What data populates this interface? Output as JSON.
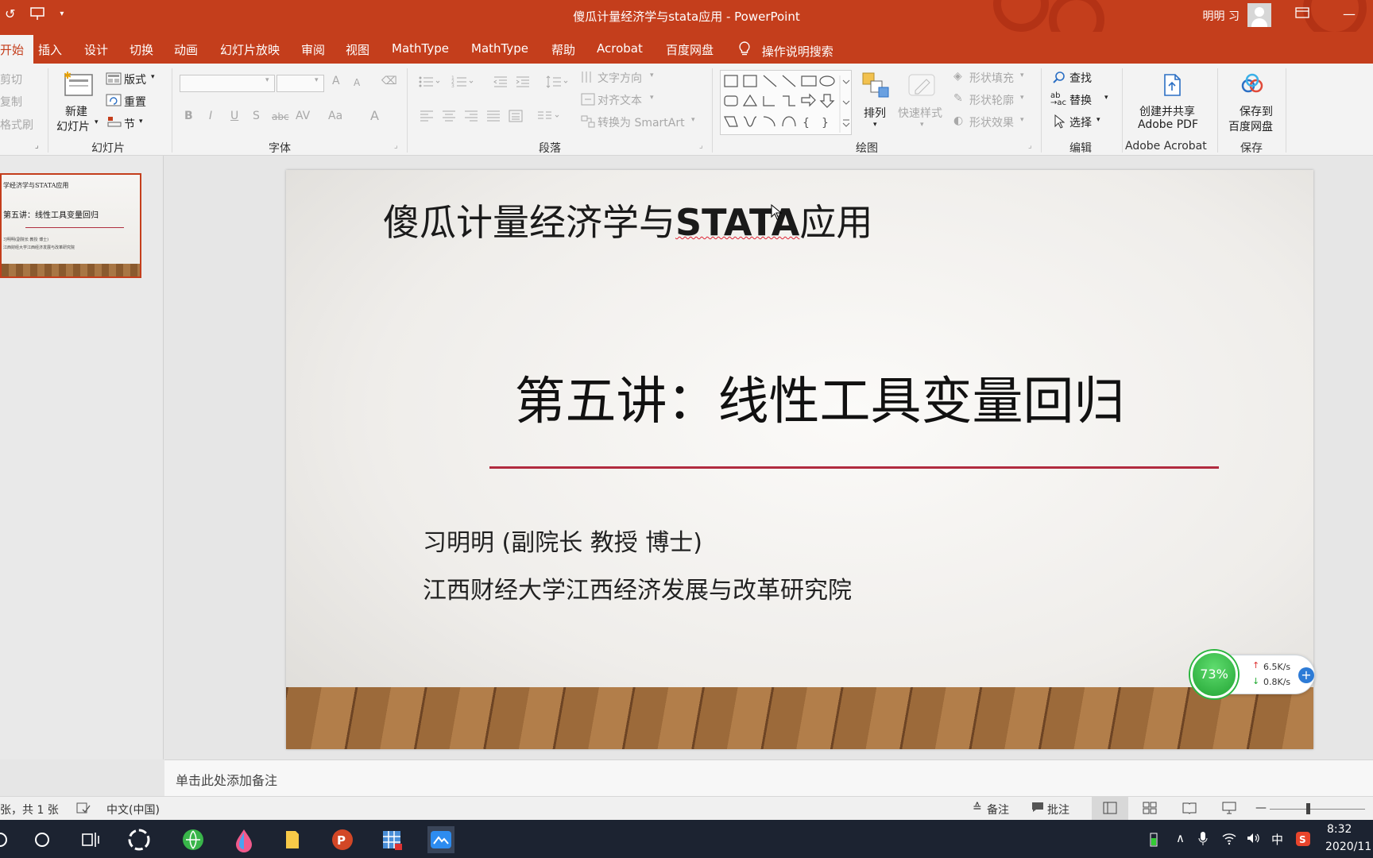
{
  "window": {
    "title": "傻瓜计量经济学与stata应用  -  PowerPoint",
    "user_name": "明明 习"
  },
  "tabs": [
    "开始",
    "插入",
    "设计",
    "切换",
    "动画",
    "幻灯片放映",
    "审阅",
    "视图",
    "MathType",
    "MathType",
    "帮助",
    "Acrobat",
    "百度网盘"
  ],
  "tell_me": "操作说明搜索",
  "ribbon": {
    "clipboard": {
      "cut": "剪切",
      "copy": "复制",
      "format_painter": "格式刷"
    },
    "slides": {
      "new_slide_1": "新建",
      "new_slide_2": "幻灯片",
      "layout": "版式",
      "reset": "重置",
      "section": "节",
      "group": "幻灯片"
    },
    "font": {
      "group": "字体",
      "bold": "B",
      "italic": "I",
      "underline": "U",
      "shadow": "S",
      "strike": "abc",
      "spacing": "AV",
      "case": "Aa",
      "color": "A",
      "grow": "A",
      "shrink": "A"
    },
    "paragraph": {
      "group": "段落",
      "text_direction": "文字方向",
      "align_text": "对齐文本",
      "smartart": "转换为 SmartArt"
    },
    "drawing": {
      "group": "绘图",
      "arrange": "排列",
      "quick_styles": "快速样式",
      "shape_fill": "形状填充",
      "shape_outline": "形状轮廓",
      "shape_effects": "形状效果"
    },
    "editing": {
      "group": "编辑",
      "find": "查找",
      "replace": "替换",
      "select": "选择"
    },
    "acrobat": {
      "group": "Adobe Acrobat",
      "create_1": "创建并共享",
      "create_2": "Adobe PDF"
    },
    "save": {
      "group": "保存",
      "save_1": "保存到",
      "save_2": "百度网盘"
    }
  },
  "thumbnail": {
    "line1": "学经济学与STATA应用",
    "line2": "第五讲：线性工具变量回归",
    "line3": "习明明(副院长 教授 博士)",
    "line4": "江西财经大学江西经济发展与改革研究院"
  },
  "slide": {
    "course_prefix": "傻瓜计量经济学与",
    "course_stata": "STATA",
    "course_suffix": "应用",
    "lecture": "第五讲：线性工具变量回归",
    "author": "习明明 (副院长 教授 博士)",
    "institution": "江西财经大学江西经济发展与改革研究院"
  },
  "speed_widget": {
    "percent": "73%",
    "upload": "6.5K/s",
    "download": "0.8K/s",
    "up_arrow": "↑",
    "down_arrow": "↓",
    "plus": "+"
  },
  "notes_placeholder": "单击此处添加备注",
  "status": {
    "slide_count": "张，共 1 张",
    "language": "中文(中国)",
    "notes": "备注",
    "comments": "批注"
  },
  "taskbar": {
    "ime": "中",
    "time": "8:32",
    "date": "2020/11"
  },
  "colors": {
    "accent": "#c43e1c",
    "rule": "#b12b3f",
    "taskbar": "#1c2331"
  }
}
